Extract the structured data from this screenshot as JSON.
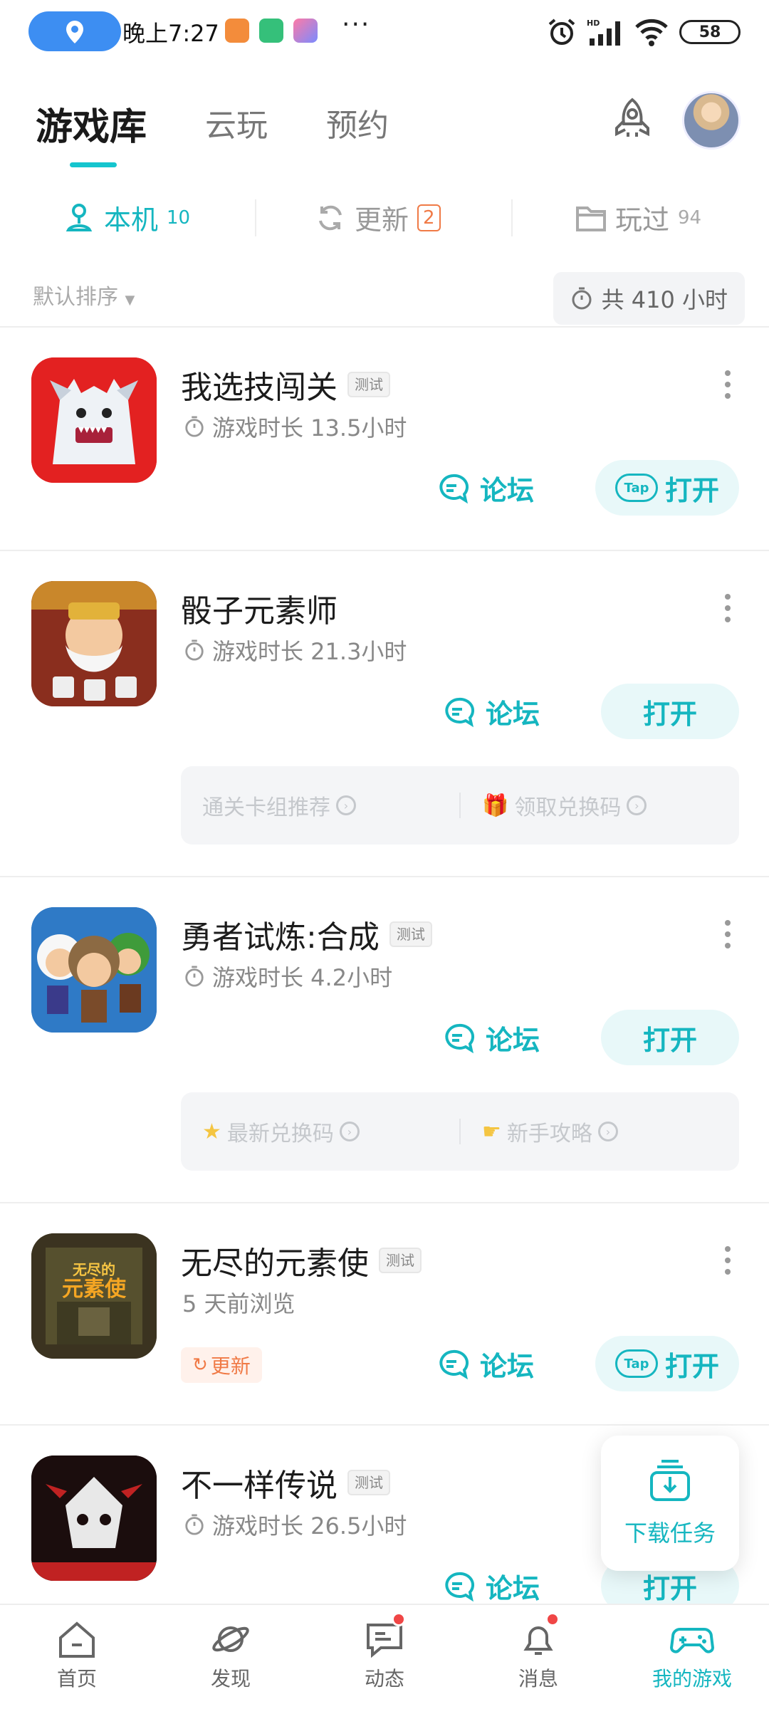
{
  "status_bar": {
    "time": "晚上7:27",
    "battery": "58",
    "more": "···"
  },
  "header": {
    "tabs": [
      {
        "label": "游戏库"
      },
      {
        "label": "云玩"
      },
      {
        "label": "预约"
      }
    ]
  },
  "subtabs": {
    "local": {
      "label": "本机",
      "count": "10"
    },
    "update": {
      "label": "更新",
      "count": "2"
    },
    "played": {
      "label": "玩过",
      "count": "94"
    }
  },
  "sort": {
    "label": "默认排序",
    "total": "共 410 小时"
  },
  "games": [
    {
      "name": "我选技闯关",
      "tag": "测试",
      "meta": "游戏时长 13.5小时",
      "forum": "论坛",
      "open": "打开"
    },
    {
      "name": "骰子元素师",
      "meta": "游戏时长 21.3小时",
      "forum": "论坛",
      "open": "打开",
      "links": [
        "通关卡组推荐",
        "领取兑换码"
      ]
    },
    {
      "name": "勇者试炼:合成",
      "tag": "测试",
      "meta": "游戏时长 4.2小时",
      "forum": "论坛",
      "open": "打开",
      "links": [
        "最新兑换码",
        "新手攻略"
      ]
    },
    {
      "name": "无尽的元素使",
      "tag": "测试",
      "meta": "5 天前浏览",
      "update": "更新",
      "forum": "论坛",
      "open": "打开"
    },
    {
      "name": "不一样传说",
      "tag": "测试",
      "meta": "游戏时长 26.5小时",
      "forum": "论坛",
      "open": "打开"
    }
  ],
  "download_task": "下载任务",
  "nav": [
    {
      "label": "首页"
    },
    {
      "label": "发现"
    },
    {
      "label": "动态"
    },
    {
      "label": "消息"
    },
    {
      "label": "我的游戏"
    }
  ],
  "colors": {
    "accent": "#15b6c0",
    "update": "#f07a46",
    "badge": "#f04646"
  }
}
